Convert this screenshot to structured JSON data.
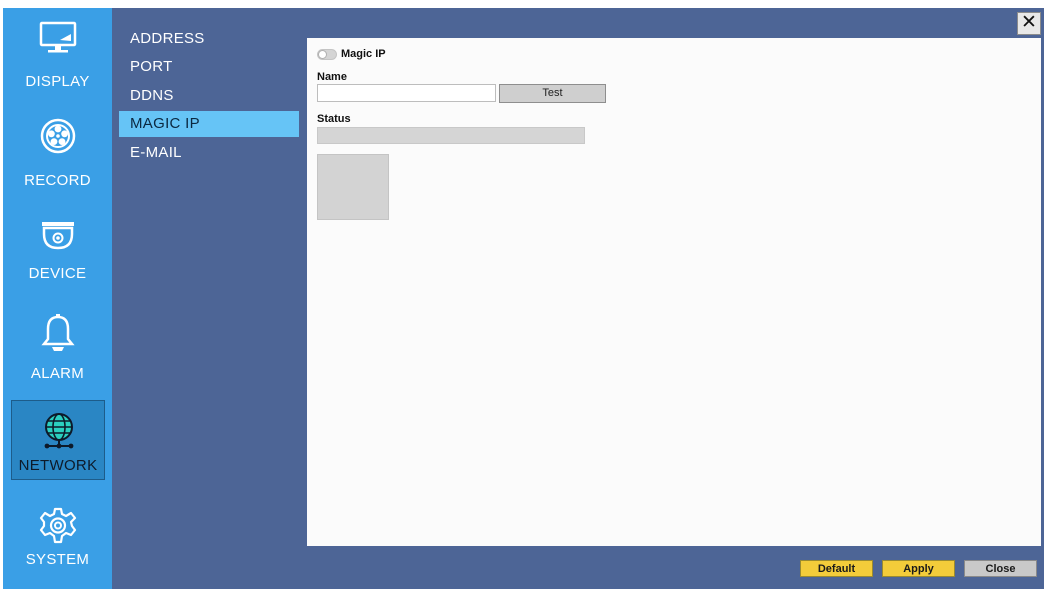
{
  "categories": [
    {
      "label": "DISPLAY",
      "icon": "display-icon"
    },
    {
      "label": "RECORD",
      "icon": "record-reel-icon"
    },
    {
      "label": "DEVICE",
      "icon": "dome-camera-icon"
    },
    {
      "label": "ALARM",
      "icon": "bell-icon"
    },
    {
      "label": "NETWORK",
      "icon": "network-globe-icon",
      "active": true
    },
    {
      "label": "SYSTEM",
      "icon": "gear-icon"
    }
  ],
  "submenu": [
    {
      "label": "ADDRESS"
    },
    {
      "label": "PORT"
    },
    {
      "label": "DDNS"
    },
    {
      "label": "MAGIC IP",
      "active": true
    },
    {
      "label": "E-MAIL"
    }
  ],
  "close_label": "✕",
  "magic_ip": {
    "toggle_label": "Magic IP",
    "enabled": false,
    "name_label": "Name",
    "name_value": "",
    "test_label": "Test",
    "status_label": "Status",
    "status_value": ""
  },
  "footer": {
    "default_label": "Default",
    "apply_label": "Apply",
    "close_label": "Close"
  },
  "colors": {
    "category_bar": "#3a9fe6",
    "main_background": "#4d6596",
    "submenu_active": "#66c4f6",
    "button_yellow": "#f3cc3a",
    "button_gray": "#c9c9c9"
  }
}
